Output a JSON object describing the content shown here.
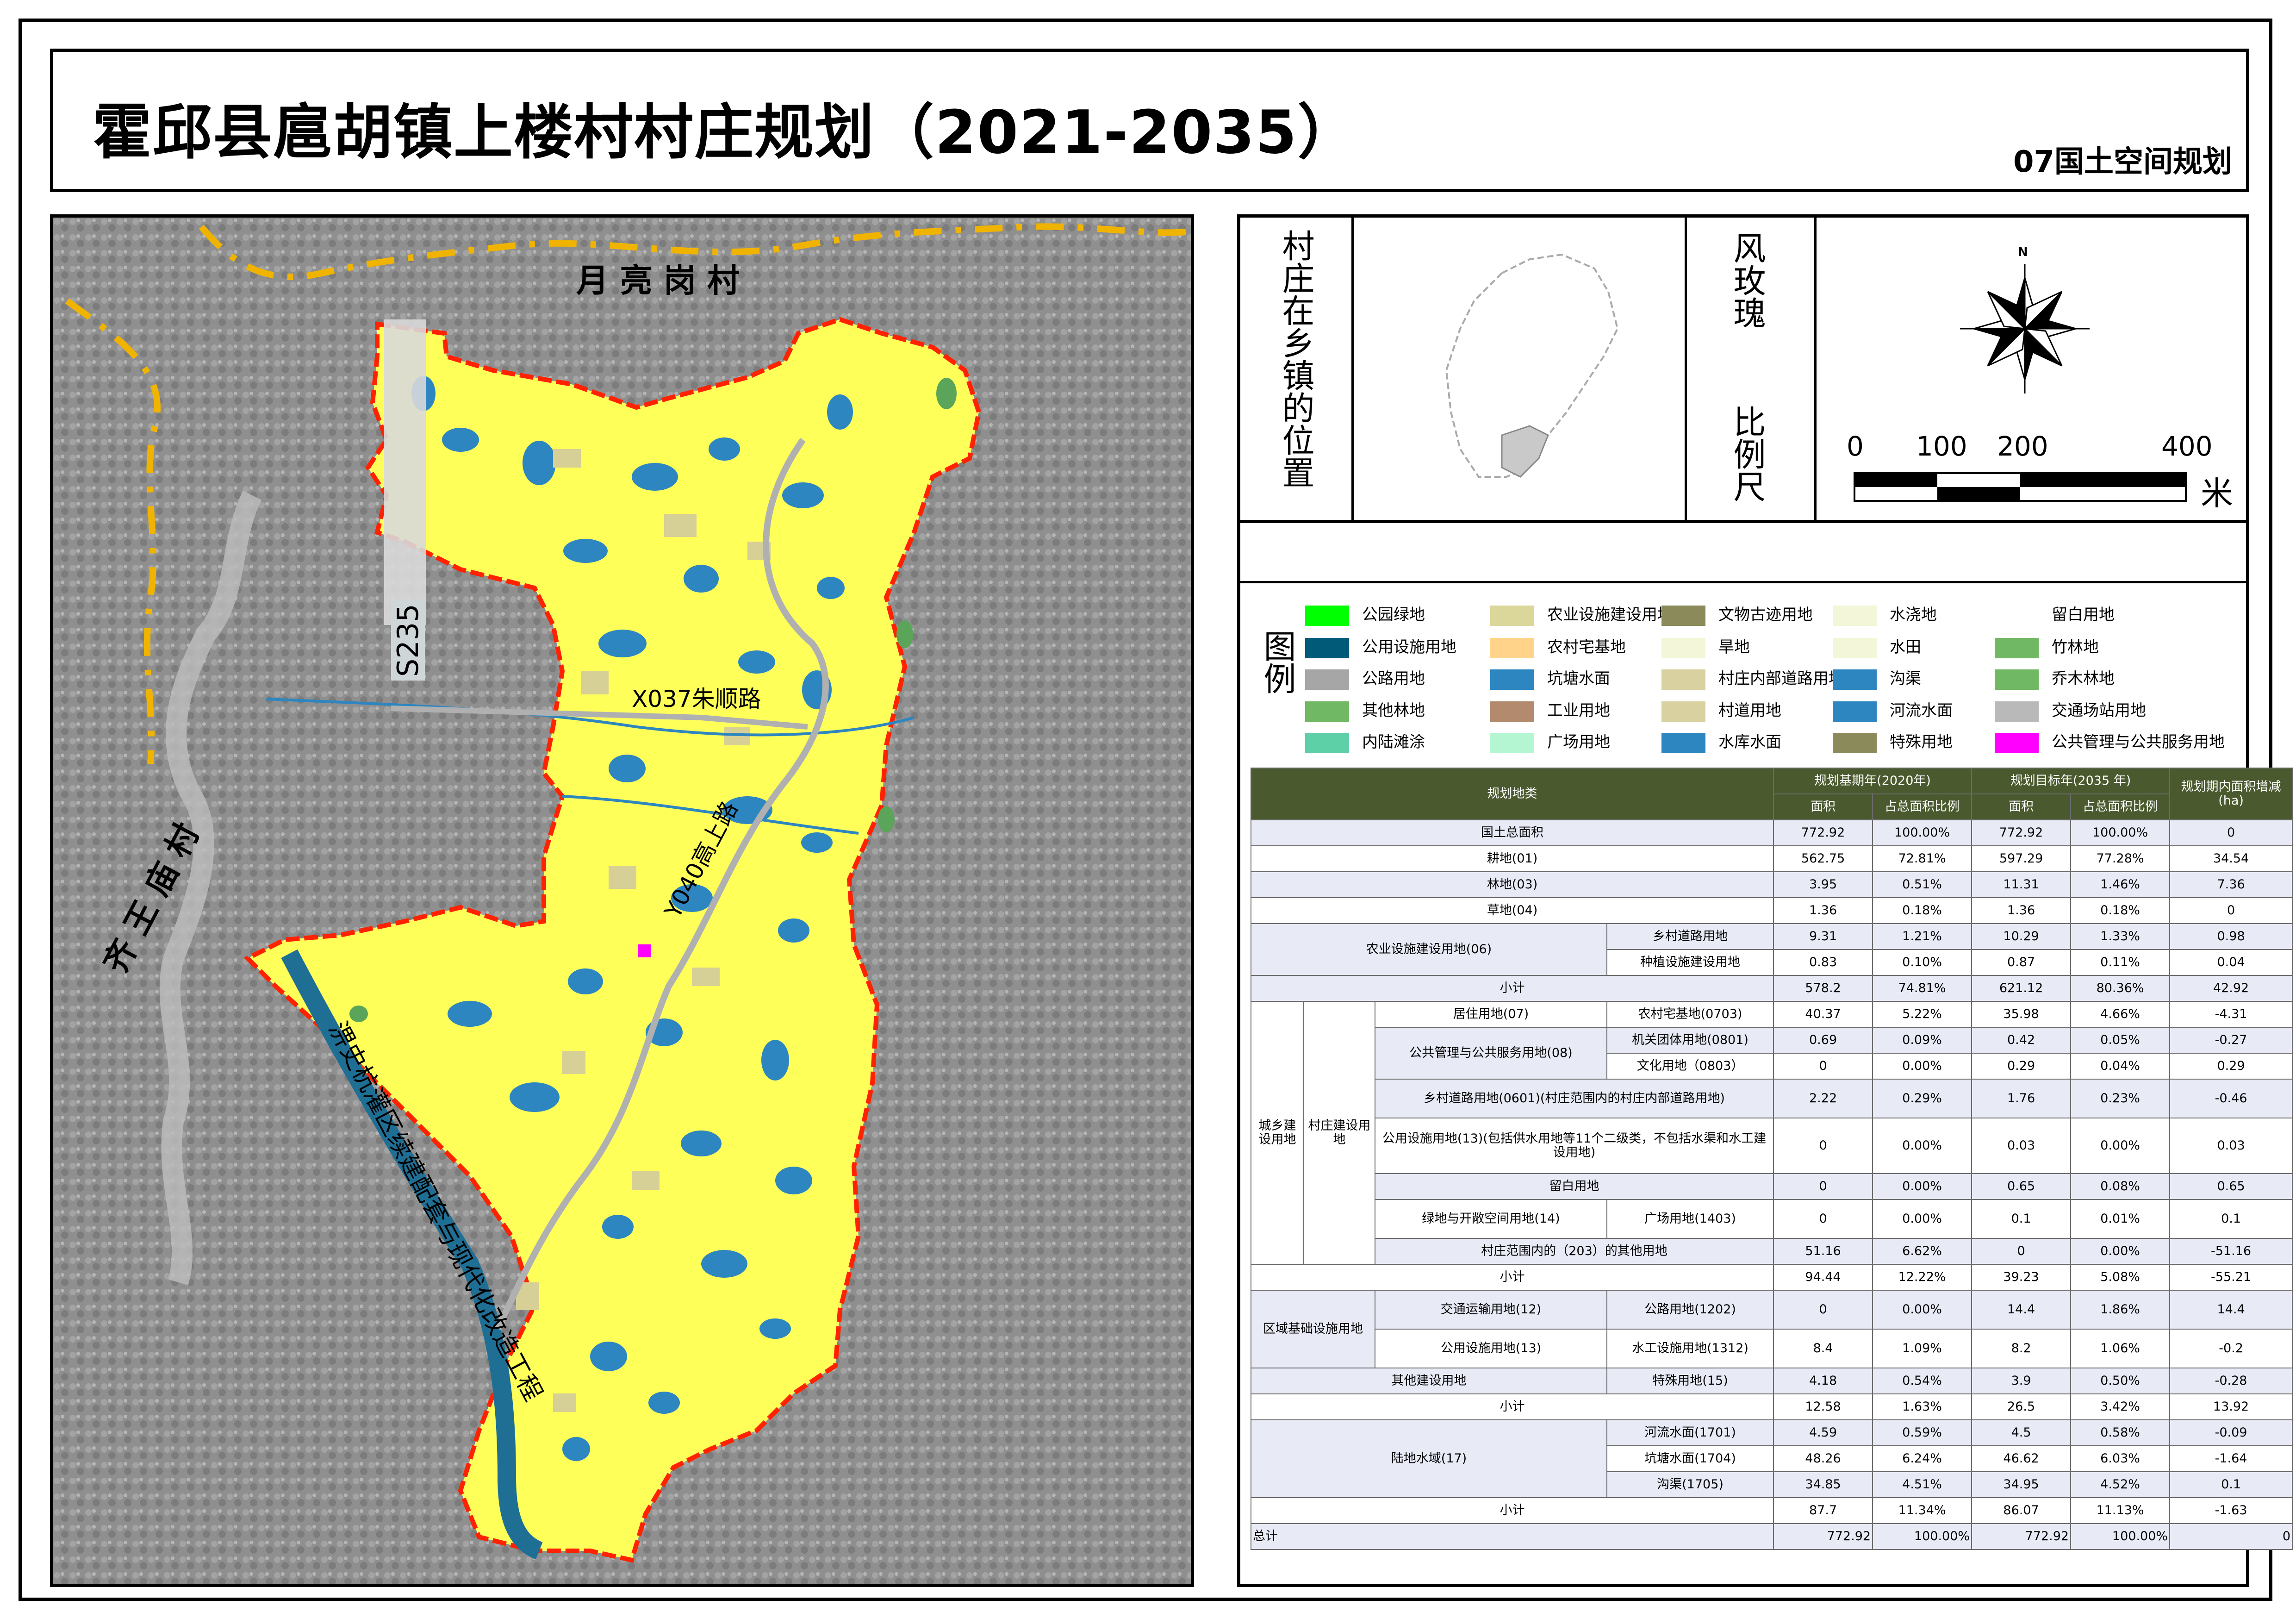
{
  "title": "霍邱县扈胡镇上楼村村庄规划（2021-2035）",
  "subtitle": "07国土空间规划",
  "map_labels": {
    "north_village": "月 亮 岗 村",
    "west_village": "齐 王 庙 村",
    "road_s235": "S235",
    "road_x037": "X037朱顺路",
    "road_y040": "Y040高上路",
    "canal_project": "淠史杭灌区续建配套与现代化改造工程"
  },
  "location_panel": {
    "title": "村庄在乡镇的位置"
  },
  "rose_panel": {
    "title_top": "风玫瑰",
    "title_bottom": "比例尺",
    "north": "N"
  },
  "scale_bar": {
    "ticks": [
      "0",
      "100",
      "200",
      "400"
    ],
    "unit": "米"
  },
  "legend": {
    "title": "图例",
    "items": [
      {
        "label": "公园绿地",
        "color": "#00ff00"
      },
      {
        "label": "农业设施建设用地",
        "color": "#dbd79a"
      },
      {
        "label": "文物古迹用地",
        "color": "#8a8a5a"
      },
      {
        "label": "水浇地",
        "color": "#f3f6d8"
      },
      {
        "label": "留白用地",
        "color": "#ffffff"
      },
      {
        "label": "公用设施用地",
        "color": "#005a78"
      },
      {
        "label": "农村宅基地",
        "color": "#ffd48a"
      },
      {
        "label": "旱地",
        "color": "#f3f6d8"
      },
      {
        "label": "水田",
        "color": "#f3f6d8"
      },
      {
        "label": "竹林地",
        "color": "#70b864"
      },
      {
        "label": "公路用地",
        "color": "#a6a6a6"
      },
      {
        "label": "坑塘水面",
        "color": "#2d86c0"
      },
      {
        "label": "村庄内部道路用地",
        "color": "#d9d2a0"
      },
      {
        "label": "沟渠",
        "color": "#2d86c0"
      },
      {
        "label": "乔木林地",
        "color": "#70b864"
      },
      {
        "label": "其他林地",
        "color": "#70b864"
      },
      {
        "label": "工业用地",
        "color": "#b48a6e"
      },
      {
        "label": "村道用地",
        "color": "#d9d2a0"
      },
      {
        "label": "河流水面",
        "color": "#2d86c0"
      },
      {
        "label": "交通场站用地",
        "color": "#b9b9b9"
      },
      {
        "label": "内陆滩涂",
        "color": "#5ed0a8"
      },
      {
        "label": "广场用地",
        "color": "#b4f5d2"
      },
      {
        "label": "水库水面",
        "color": "#2d86c0"
      },
      {
        "label": "特殊用地",
        "color": "#8a8a5a"
      },
      {
        "label": "公共管理与公共服务用地",
        "color": "#ff00ff"
      }
    ]
  },
  "table": {
    "header": {
      "category": "规划地类",
      "base_year": "规划基期年(2020年)",
      "target_year": "规划目标年(2035 年)",
      "change": "规划期内面积增减(ha)",
      "area": "面积",
      "ratio": "占总面积比例"
    },
    "rows": [
      {
        "c": "国土总面积",
        "a1": "772.92",
        "r1": "100.00%",
        "a2": "772.92",
        "r2": "100.00%",
        "d": "0"
      },
      {
        "c": "耕地(01)",
        "a1": "562.75",
        "r1": "72.81%",
        "a2": "597.29",
        "r2": "77.28%",
        "d": "34.54"
      },
      {
        "c": "林地(03)",
        "a1": "3.95",
        "r1": "0.51%",
        "a2": "11.31",
        "r2": "1.46%",
        "d": "7.36"
      },
      {
        "c": "草地(04)",
        "a1": "1.36",
        "r1": "0.18%",
        "a2": "1.36",
        "r2": "0.18%",
        "d": "0"
      },
      {
        "g": "农业设施建设用地(06)",
        "c": "乡村道路用地",
        "a1": "9.31",
        "r1": "1.21%",
        "a2": "10.29",
        "r2": "1.33%",
        "d": "0.98"
      },
      {
        "c": "种植设施建设用地",
        "a1": "0.83",
        "r1": "0.10%",
        "a2": "0.87",
        "r2": "0.11%",
        "d": "0.04"
      },
      {
        "c": "小计",
        "a1": "578.2",
        "r1": "74.81%",
        "a2": "621.12",
        "r2": "80.36%",
        "d": "42.92"
      },
      {
        "g1": "城乡建设用地",
        "g2": "村庄建设用地",
        "g3": "居住用地(07)",
        "c": "农村宅基地(0703)",
        "a1": "40.37",
        "r1": "5.22%",
        "a2": "35.98",
        "r2": "4.66%",
        "d": "-4.31"
      },
      {
        "g3": "公共管理与公共服务用地(08)",
        "c": "机关团体用地(0801)",
        "a1": "0.69",
        "r1": "0.09%",
        "a2": "0.42",
        "r2": "0.05%",
        "d": "-0.27"
      },
      {
        "c": "文化用地（0803）",
        "a1": "0",
        "r1": "0.00%",
        "a2": "0.29",
        "r2": "0.04%",
        "d": "0.29"
      },
      {
        "c": "乡村道路用地(0601)(村庄范围内的村庄内部道路用地)",
        "a1": "2.22",
        "r1": "0.29%",
        "a2": "1.76",
        "r2": "0.23%",
        "d": "-0.46"
      },
      {
        "c": "公用设施用地(13)(包括供水用地等11个二级类，不包括水渠和水工建设用地)",
        "a1": "0",
        "r1": "0.00%",
        "a2": "0.03",
        "r2": "0.00%",
        "d": "0.03"
      },
      {
        "c": "留白用地",
        "a1": "0",
        "r1": "0.00%",
        "a2": "0.65",
        "r2": "0.08%",
        "d": "0.65"
      },
      {
        "g3": "绿地与开敞空间用地(14)",
        "c": "广场用地(1403)",
        "a1": "0",
        "r1": "0.00%",
        "a2": "0.1",
        "r2": "0.01%",
        "d": "0.1"
      },
      {
        "c": "村庄范围内的（203）的其他用地",
        "a1": "51.16",
        "r1": "6.62%",
        "a2": "0",
        "r2": "0.00%",
        "d": "-51.16"
      },
      {
        "c": "小计",
        "a1": "94.44",
        "r1": "12.22%",
        "a2": "39.23",
        "r2": "5.08%",
        "d": "-55.21"
      },
      {
        "g": "区域基础设施用地",
        "g2": "交通运输用地(12)",
        "c": "公路用地(1202)",
        "a1": "0",
        "r1": "0.00%",
        "a2": "14.4",
        "r2": "1.86%",
        "d": "14.4"
      },
      {
        "g2": "公用设施用地(13)",
        "c": "水工设施用地(1312)",
        "a1": "8.4",
        "r1": "1.09%",
        "a2": "8.2",
        "r2": "1.06%",
        "d": "-0.2"
      },
      {
        "g": "其他建设用地",
        "c": "特殊用地(15)",
        "a1": "4.18",
        "r1": "0.54%",
        "a2": "3.9",
        "r2": "0.50%",
        "d": "-0.28"
      },
      {
        "c": "小计",
        "a1": "12.58",
        "r1": "1.63%",
        "a2": "26.5",
        "r2": "3.42%",
        "d": "13.92"
      },
      {
        "g": "陆地水域(17)",
        "c": "河流水面(1701)",
        "a1": "4.59",
        "r1": "0.59%",
        "a2": "4.5",
        "r2": "0.58%",
        "d": "-0.09"
      },
      {
        "c": "坑塘水面(1704)",
        "a1": "48.26",
        "r1": "6.24%",
        "a2": "46.62",
        "r2": "6.03%",
        "d": "-1.64"
      },
      {
        "c": "沟渠(1705)",
        "a1": "34.85",
        "r1": "4.51%",
        "a2": "34.95",
        "r2": "4.52%",
        "d": "0.1"
      },
      {
        "c": "小计",
        "a1": "87.7",
        "r1": "11.34%",
        "a2": "86.07",
        "r2": "11.13%",
        "d": "-1.63"
      },
      {
        "c": "总计",
        "a1": "772.92",
        "r1": "100.00%",
        "a2": "772.92",
        "r2": "100.00%",
        "d": "0"
      }
    ]
  }
}
